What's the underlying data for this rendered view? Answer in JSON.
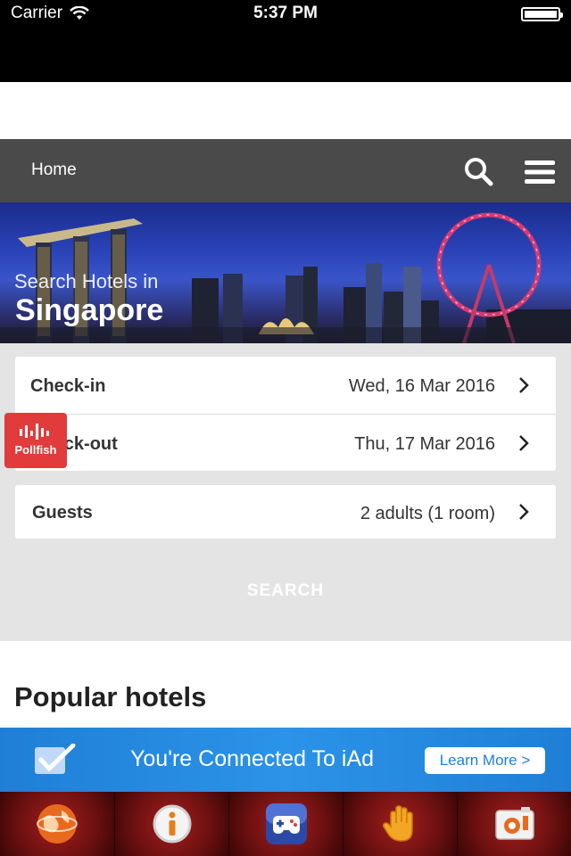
{
  "status_bar": {
    "carrier": "Carrier",
    "time": "5:37 PM"
  },
  "nav": {
    "home_label": "Home"
  },
  "hero": {
    "subtitle": "Search Hotels in",
    "city": "Singapore"
  },
  "form": {
    "checkin_label": "Check-in",
    "checkin_value": "Wed, 16 Mar 2016",
    "checkout_label": "Check-out",
    "checkout_value": "Thu, 17 Mar 2016",
    "guests_label": "Guests",
    "guests_value": "2 adults (1 room)",
    "search_label": "SEARCH"
  },
  "pollfish": {
    "label": "Pollfish"
  },
  "section": {
    "popular_title": "Popular hotels"
  },
  "ad": {
    "text": "You're Connected To iAd",
    "button": "Learn More >"
  },
  "bottom_bar": {
    "icons": [
      "globe-icon",
      "info-icon",
      "gamepad-icon",
      "hand-icon",
      "camera-icon"
    ]
  },
  "colors": {
    "nav_bg": "#4a4a4a",
    "pollfish_red": "#e23b3b",
    "iad_blue": "#1f7fd6",
    "form_bg": "#e4e4e4"
  }
}
